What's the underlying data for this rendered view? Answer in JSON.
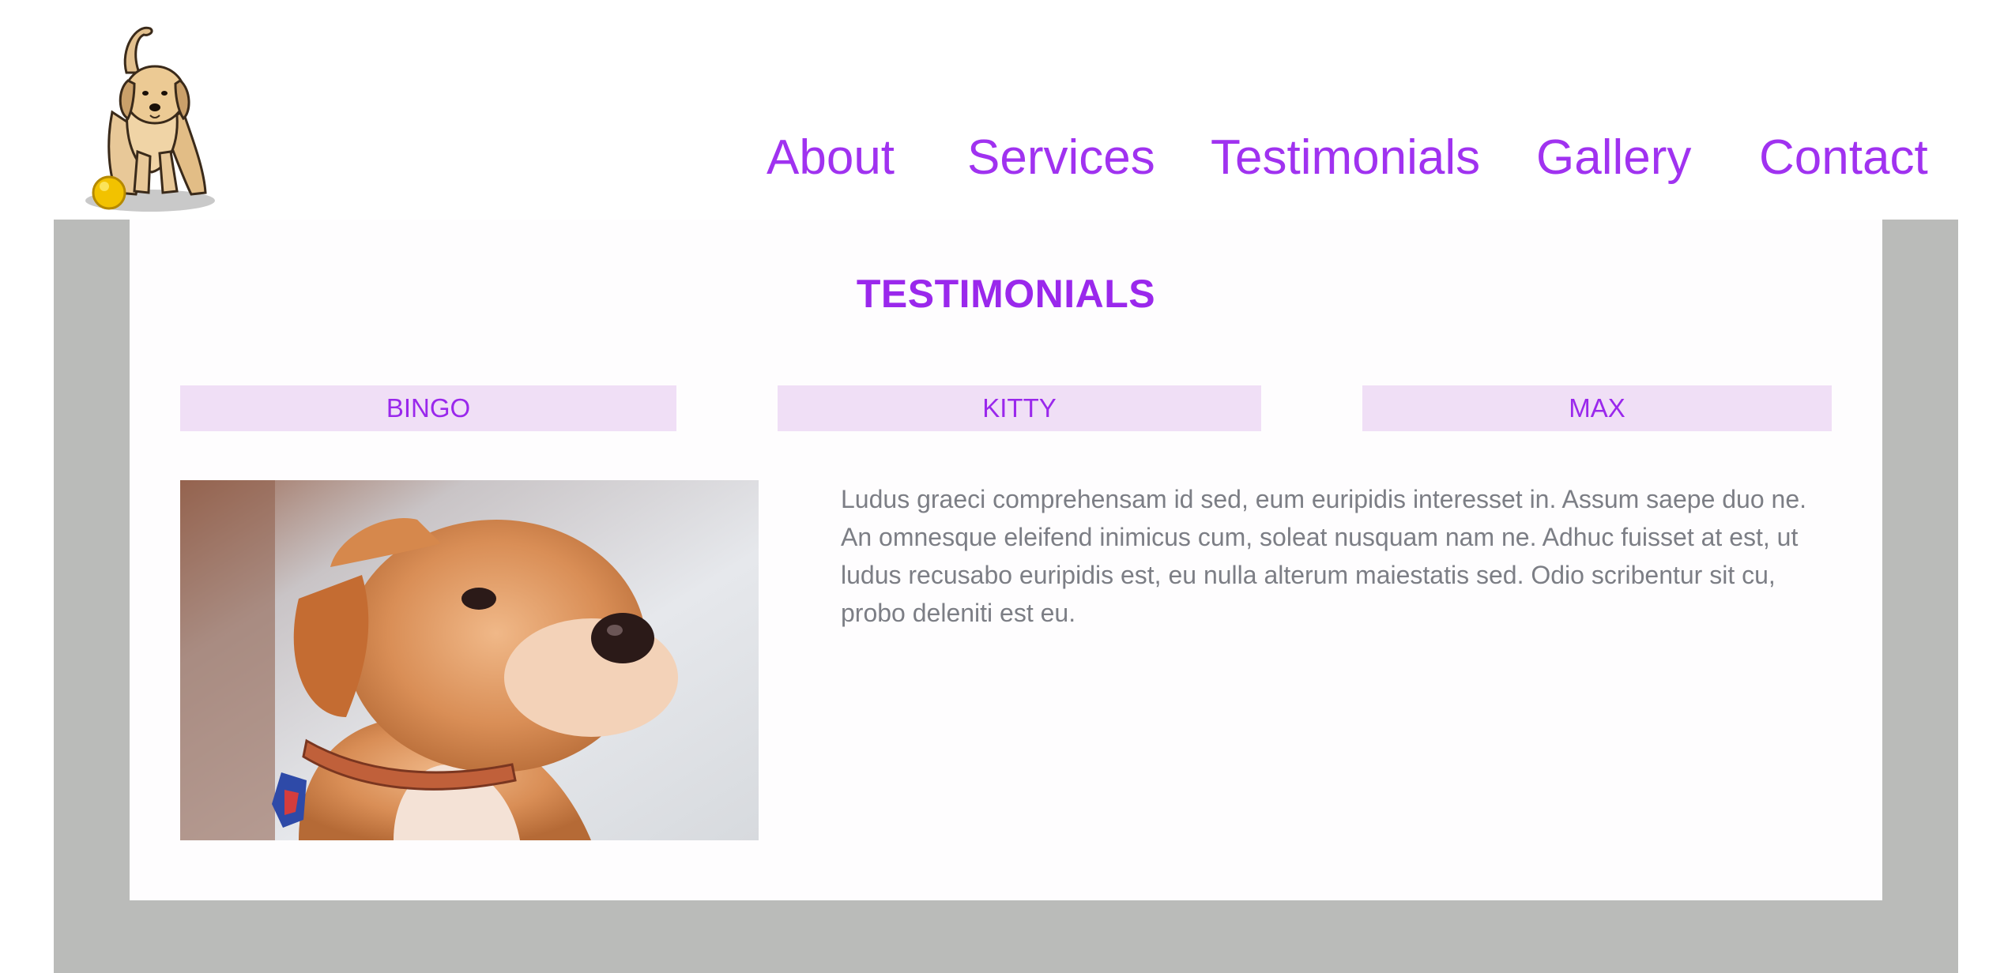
{
  "nav": {
    "items": [
      {
        "label": "About"
      },
      {
        "label": "Services"
      },
      {
        "label": "Testimonials"
      },
      {
        "label": "Gallery"
      },
      {
        "label": "Contact"
      }
    ]
  },
  "logo": {
    "icon": "puppy-with-ball-icon"
  },
  "testimonials": {
    "title": "TESTIMONIALS",
    "tabs": [
      {
        "label": "BINGO"
      },
      {
        "label": "KITTY"
      },
      {
        "label": "MAX"
      }
    ],
    "active": {
      "image": "puppy-photo",
      "text": "Ludus graeci comprehensam id sed, eum euripidis interesset in. Assum saepe duo ne. An omnesque eleifend inimicus cum, soleat nusquam nam ne. Adhuc fuisset at est, ut ludus recusabo euripidis est, eu nulla alterum maiestatis sed. Odio scribentur sit cu, probo deleniti est eu."
    }
  },
  "colors": {
    "accent": "#9a28ec",
    "tab_background": "#f0dff6",
    "frame": "#babbb9",
    "body_text": "#7c7e85"
  }
}
